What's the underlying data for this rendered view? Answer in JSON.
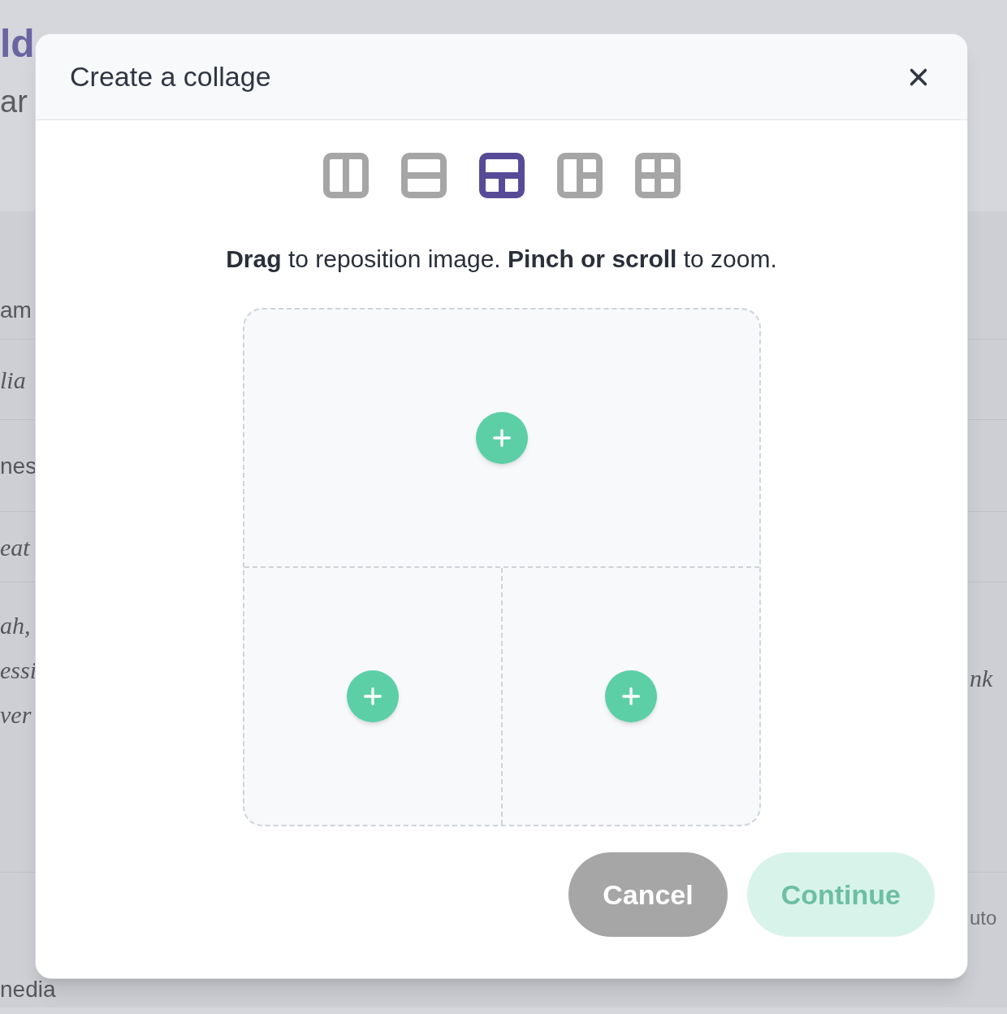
{
  "background": {
    "title": "ld",
    "subtitle": "ar",
    "rows": [
      {
        "left": "am",
        "kind": "label"
      },
      {
        "left": "lia",
        "kind": "handwriting"
      },
      {
        "left": "nes",
        "kind": "label"
      },
      {
        "left": "eat",
        "kind": "handwriting"
      },
      {
        "left": "ah,\nessi\nver",
        "kind": "handwriting",
        "right": "nk"
      },
      {
        "kind": "label",
        "right": "uto"
      },
      {
        "left": "nedia",
        "kind": "label"
      }
    ]
  },
  "dialog": {
    "title": "Create a collage",
    "layouts": [
      {
        "kind": "two-columns",
        "selected": false
      },
      {
        "kind": "two-rows",
        "selected": false
      },
      {
        "kind": "top-and-two-bottom",
        "selected": true
      },
      {
        "kind": "left-and-two-right",
        "selected": false
      },
      {
        "kind": "grid-four",
        "selected": false
      }
    ],
    "instructions": "**Drag** to reposition image. **Pinch or scroll** to zoom.",
    "buttons": [
      {
        "label": "Cancel",
        "kind": "secondary",
        "disabled": false
      },
      {
        "label": "Continue",
        "kind": "primary",
        "disabled": true
      }
    ]
  }
}
